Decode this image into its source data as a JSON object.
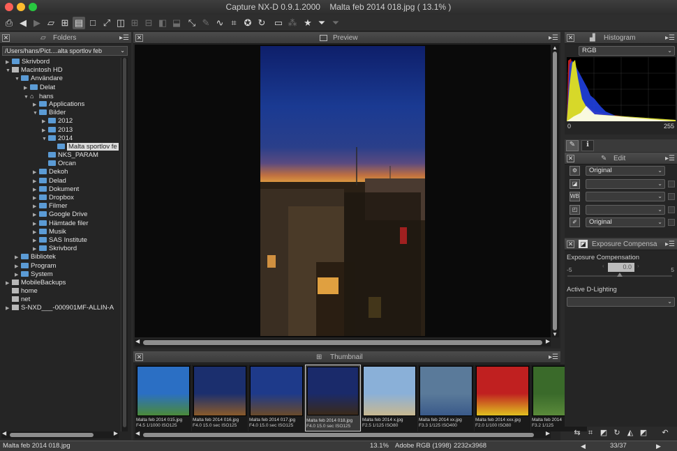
{
  "window": {
    "title": "Capture NX-D 0.9.1.2000",
    "document": "Malta feb 2014 018.jpg ( 13.1% )"
  },
  "toolbar": {
    "icons": [
      "print-icon",
      "arrow-left-icon",
      "arrow-right-icon",
      "open-folder-icon",
      "grid-view-icon",
      "preview-filmstrip-icon",
      "single-view-icon",
      "fullscreen-icon",
      "compare-icon",
      "compare-grid-icon",
      "compare-split-icon",
      "compare-lr-icon",
      "compare-tb-icon",
      "straighten-icon",
      "eyedropper-icon",
      "levels-icon",
      "crop-icon",
      "retouch-icon",
      "rotate-icon",
      "monitor-icon",
      "color-control-icon",
      "star-icon",
      "filter-icon",
      "filter-clear-icon"
    ]
  },
  "folders": {
    "title": "Folders",
    "path": "/Users/hans/Pict....alta sportlov feb",
    "items": [
      {
        "label": "Skrivbord",
        "level": 0,
        "arrow": "▶",
        "icon": "folder"
      },
      {
        "label": "Macintosh HD",
        "level": 0,
        "arrow": "▼",
        "icon": "drive"
      },
      {
        "label": "Användare",
        "level": 1,
        "arrow": "▼",
        "icon": "folder"
      },
      {
        "label": "Delat",
        "level": 2,
        "arrow": "▶",
        "icon": "folder"
      },
      {
        "label": "hans",
        "level": 2,
        "arrow": "▼",
        "icon": "home"
      },
      {
        "label": "Applications",
        "level": 3,
        "arrow": "▶",
        "icon": "folder"
      },
      {
        "label": "Bilder",
        "level": 3,
        "arrow": "▼",
        "icon": "folder"
      },
      {
        "label": "2012",
        "level": 4,
        "arrow": "▶",
        "icon": "folder"
      },
      {
        "label": "2013",
        "level": 4,
        "arrow": "▶",
        "icon": "folder"
      },
      {
        "label": "2014",
        "level": 4,
        "arrow": "▼",
        "icon": "folder"
      },
      {
        "label": "Malta sportlov fe",
        "level": 5,
        "arrow": "",
        "icon": "folder",
        "selected": true
      },
      {
        "label": "NKS_PARAM",
        "level": 4,
        "arrow": "",
        "icon": "folder"
      },
      {
        "label": "Orcan",
        "level": 4,
        "arrow": "",
        "icon": "folder"
      },
      {
        "label": "Dekoh",
        "level": 3,
        "arrow": "▶",
        "icon": "folder"
      },
      {
        "label": "Delad",
        "level": 3,
        "arrow": "▶",
        "icon": "folder"
      },
      {
        "label": "Dokument",
        "level": 3,
        "arrow": "▶",
        "icon": "folder"
      },
      {
        "label": "Dropbox",
        "level": 3,
        "arrow": "▶",
        "icon": "folder"
      },
      {
        "label": "Filmer",
        "level": 3,
        "arrow": "▶",
        "icon": "folder"
      },
      {
        "label": "Google Drive",
        "level": 3,
        "arrow": "▶",
        "icon": "folder"
      },
      {
        "label": "Hämtade filer",
        "level": 3,
        "arrow": "▶",
        "icon": "folder"
      },
      {
        "label": "Musik",
        "level": 3,
        "arrow": "▶",
        "icon": "folder"
      },
      {
        "label": "SAS Institute",
        "level": 3,
        "arrow": "▶",
        "icon": "folder"
      },
      {
        "label": "Skrivbord",
        "level": 3,
        "arrow": "▶",
        "icon": "folder"
      },
      {
        "label": "Bibliotek",
        "level": 1,
        "arrow": "▶",
        "icon": "folder"
      },
      {
        "label": "Program",
        "level": 1,
        "arrow": "▶",
        "icon": "folder"
      },
      {
        "label": "System",
        "level": 1,
        "arrow": "▶",
        "icon": "folder"
      },
      {
        "label": "MobileBackups",
        "level": 0,
        "arrow": "▶",
        "icon": "drive"
      },
      {
        "label": "home",
        "level": 0,
        "arrow": "",
        "icon": "drive"
      },
      {
        "label": "net",
        "level": 0,
        "arrow": "",
        "icon": "drive"
      },
      {
        "label": "S-NXD___-000901MF-ALLIN-A",
        "level": 0,
        "arrow": "▶",
        "icon": "drive"
      }
    ]
  },
  "preview": {
    "title": "Preview"
  },
  "thumbnail": {
    "title": "Thumbnail",
    "items": [
      {
        "name": "Malta feb 2014 015.jpg",
        "info": "F4.5  1/1000  ISO125",
        "c1": "#2b6fc4",
        "c2": "#4a8a3a"
      },
      {
        "name": "Malta feb 2014 016.jpg",
        "info": "F4.0  15.0 sec  ISO125",
        "c1": "#1b2f6e",
        "c2": "#8a5a2a"
      },
      {
        "name": "Malta feb 2014 017.jpg",
        "info": "F4.0  15.0 sec  ISO125",
        "c1": "#1e3a8a",
        "c2": "#6a4a2a"
      },
      {
        "name": "Malta feb 2014 018.jpg",
        "info": "F4.0  15.0 sec  ISO125",
        "c1": "#1a2a6a",
        "c2": "#3a2a1a",
        "selected": true
      },
      {
        "name": "Malta feb 2014 x.jpg",
        "info": "F2.5  1/125   ISO80",
        "c1": "#8ab0d8",
        "c2": "#c8b890"
      },
      {
        "name": "Malta feb 2014 xx.jpg",
        "info": "F3.3  1/125  ISO400",
        "c1": "#5a7a9a",
        "c2": "#3a5a8a"
      },
      {
        "name": "Malta feb 2014 xxx.jpg",
        "info": "F2.0  1/100   ISO80",
        "c1": "#c02020",
        "c2": "#e0c020"
      },
      {
        "name": "Malta feb 2014",
        "info": "F3.2  1/125",
        "c1": "#3a6a2a",
        "c2": "#5a8a3a"
      }
    ]
  },
  "histogram": {
    "title": "Histogram",
    "channel": "RGB",
    "min_label": "0",
    "max_label": "255"
  },
  "edit": {
    "title": "Edit",
    "rows": [
      {
        "icon": "gear-icon",
        "value": "Original"
      },
      {
        "icon": "picture-control-icon",
        "value": ""
      },
      {
        "icon": "white-balance-icon",
        "value": ""
      },
      {
        "icon": "exposure-icon",
        "value": ""
      },
      {
        "icon": "brush-icon",
        "value": "Original"
      }
    ]
  },
  "exposure": {
    "title": "Exposure Compensa",
    "label": "Exposure Compensation",
    "min": "-5",
    "max": "5",
    "value": "0.0",
    "level": 0.5,
    "adl_label": "Active D-Lighting",
    "adl_value": ""
  },
  "status": {
    "filename": "Malta feb 2014 018.jpg",
    "zoom": "13.1%",
    "colorspace": "Adobe RGB (1998)",
    "dimensions": "2232x3968",
    "page": "33/37"
  },
  "colors": {
    "accent": "#5b9bd5",
    "panel_bg": "#252525",
    "header_bg": "#404040"
  }
}
